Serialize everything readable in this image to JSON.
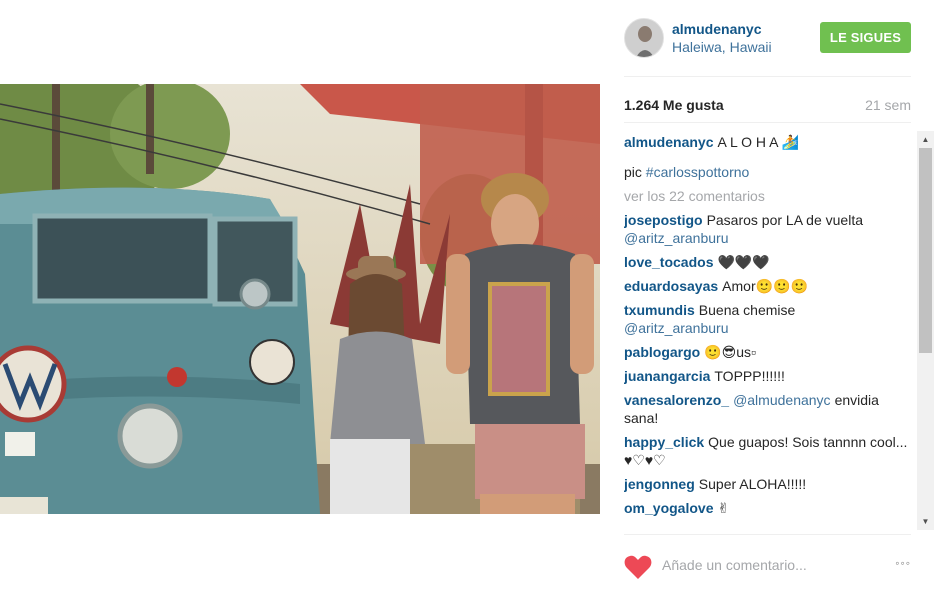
{
  "post": {
    "username": "almudenanyc",
    "location": "Haleiwa, Hawaii",
    "follow_label": "LE SIGUES",
    "likes": "1.264 Me gusta",
    "age": "21 sem"
  },
  "caption": {
    "username": "almudenanyc",
    "text": "A L O H A 🏄",
    "pic_prefix": "pic ",
    "pic_tag": "#carlosspottorno"
  },
  "view_all": "ver los 22 comentarios",
  "comments": [
    {
      "user": "josepostigo",
      "text": "Pasaros por LA de vuelta",
      "mention": "@aritz_aranburu"
    },
    {
      "user": "love_tocados",
      "text": "🖤🖤🖤"
    },
    {
      "user": "eduardosayas",
      "text": "Amor🙂🙂🙂"
    },
    {
      "user": "txumundis",
      "text": "Buena chemise",
      "mention": "@aritz_aranburu"
    },
    {
      "user": "pablogargo",
      "text": "🙂😎us▫"
    },
    {
      "user": "juanangarcia",
      "text": "TOPPP!!!!!!"
    },
    {
      "user": "vanesalorenzo_",
      "mention_inline": "@almudenanyc",
      "text": "envidia sana!"
    },
    {
      "user": "happy_click",
      "text": "Que guapos! Sois tannnn cool... ♥♡♥♡"
    },
    {
      "user": "jengonneg",
      "text": "Super ALOHA!!!!!"
    },
    {
      "user": "om_yogalove",
      "text": "✌"
    }
  ],
  "footer": {
    "comment_placeholder": "Añade un comentario...",
    "more": "◦◦◦"
  },
  "icons": {
    "heart": "heart-icon",
    "more": "more-options-icon"
  },
  "colors": {
    "follow": "#70c050",
    "heart": "#ed4956",
    "username": "#125688",
    "link": "#3f729b"
  }
}
